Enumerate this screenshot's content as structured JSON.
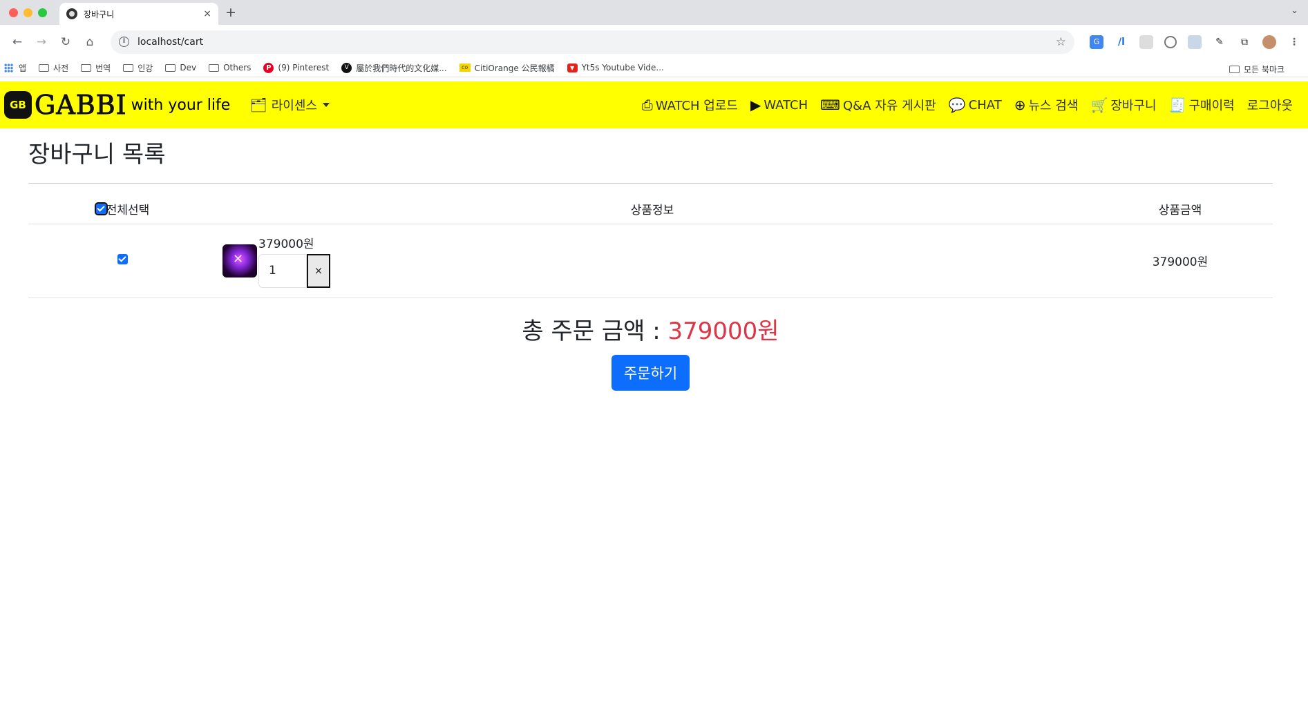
{
  "browser": {
    "tab_title": "장바구니",
    "tab_close": "×",
    "new_tab": "+",
    "tab_menu": "⌄",
    "url": "localhost/cart",
    "bookmarks": [
      {
        "label": "앱",
        "icon": "apps-icon"
      },
      {
        "label": "사전",
        "icon": "folder-icon"
      },
      {
        "label": "번역",
        "icon": "folder-icon"
      },
      {
        "label": "인강",
        "icon": "folder-icon"
      },
      {
        "label": "Dev",
        "icon": "folder-icon"
      },
      {
        "label": "Others",
        "icon": "folder-icon"
      },
      {
        "label": "(9) Pinterest",
        "icon": "pinterest-icon"
      },
      {
        "label": "屬於我們時代的文化媒...",
        "icon": "v-icon"
      },
      {
        "label": "CitiOrange 公民報橘",
        "icon": "citiorange-icon"
      },
      {
        "label": "Yt5s Youtube Vide...",
        "icon": "yt5s-icon"
      }
    ],
    "all_bookmarks": "모든 북마크"
  },
  "navbar": {
    "logo_mark": "GB",
    "logo_text": "GABBI",
    "tagline": "with your life",
    "license_dropdown": "라이센스",
    "menu": [
      {
        "label": "WATCH 업로드",
        "icon": "video-upload-icon"
      },
      {
        "label": "WATCH",
        "icon": "video-play-icon"
      },
      {
        "label": "Q&A 자유 게시판",
        "icon": "translate-board-icon"
      },
      {
        "label": "CHAT",
        "icon": "chat-bubble-icon"
      },
      {
        "label": "뉴스 검색",
        "icon": "globe-icon"
      },
      {
        "label": "장바구니",
        "icon": "cart-icon"
      },
      {
        "label": "구매이력",
        "icon": "receipt-icon"
      },
      {
        "label": "로그아웃",
        "icon": ""
      }
    ]
  },
  "cart": {
    "title": "장바구니 목록",
    "headers": {
      "select_all": "전체선택",
      "product_info": "상품정보",
      "product_price": "상품금액"
    },
    "items": [
      {
        "price": "379000원",
        "quantity": "1",
        "remove": "×",
        "line_total": "379000원",
        "checked": true
      }
    ],
    "total_label": "총 주문 금액 : ",
    "total_amount": "379000원",
    "order_button": "주문하기"
  },
  "colors": {
    "navbar_bg": "#ffff00",
    "accent_blue": "#0d6efd",
    "total_red": "#dc3545"
  }
}
